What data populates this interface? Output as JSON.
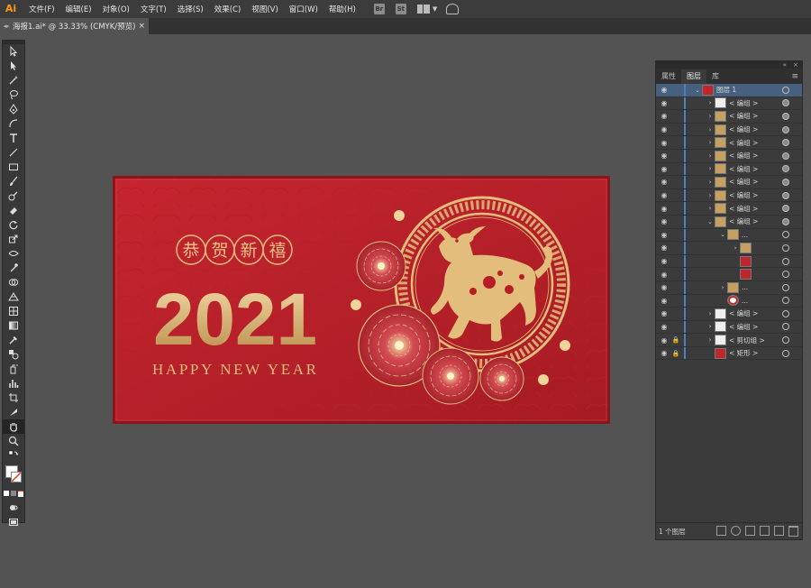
{
  "app": {
    "logo": "Ai"
  },
  "menu": [
    "文件(F)",
    "编辑(E)",
    "对象(O)",
    "文字(T)",
    "选择(S)",
    "效果(C)",
    "视图(V)",
    "窗口(W)",
    "帮助(H)"
  ],
  "toolbar_icons": {
    "bridge": "Br",
    "stock": "St"
  },
  "document_tab": {
    "title": "海报1.ai* @ 33.33% (CMYK/预览)",
    "close": "×"
  },
  "artwork": {
    "chars": [
      "恭",
      "贺",
      "新",
      "禧"
    ],
    "year": "2021",
    "greeting": "HAPPY NEW YEAR",
    "colors": {
      "background": "#b81d26",
      "gold": "#e2bd7c",
      "dark_gold": "#a97a3c",
      "flower": "#c32f3a"
    }
  },
  "layers_panel": {
    "tabs": [
      "属性",
      "图层",
      "库"
    ],
    "menu_icon": "≡",
    "collapse": "«",
    "close": "×",
    "rows": [
      {
        "name": "图层 1",
        "depth": 0,
        "arrow": "open",
        "thumb": "red",
        "selected": true,
        "target": "ring"
      },
      {
        "name": "< 编组 >",
        "depth": 1,
        "arrow": "closed",
        "thumb": "white",
        "target": "filled"
      },
      {
        "name": "< 编组 >",
        "depth": 1,
        "arrow": "closed",
        "thumb": "gold",
        "target": "filled"
      },
      {
        "name": "< 编组 >",
        "depth": 1,
        "arrow": "closed",
        "thumb": "gold",
        "target": "filled"
      },
      {
        "name": "< 编组 >",
        "depth": 1,
        "arrow": "closed",
        "thumb": "gold",
        "target": "filled"
      },
      {
        "name": "< 编组 >",
        "depth": 1,
        "arrow": "closed",
        "thumb": "gold",
        "target": "filled"
      },
      {
        "name": "< 编组 >",
        "depth": 1,
        "arrow": "closed",
        "thumb": "gold",
        "target": "filled"
      },
      {
        "name": "< 编组 >",
        "depth": 1,
        "arrow": "closed",
        "thumb": "gold",
        "target": "filled"
      },
      {
        "name": "< 编组 >",
        "depth": 1,
        "arrow": "closed",
        "thumb": "gold",
        "target": "filled"
      },
      {
        "name": "< 编组 >",
        "depth": 1,
        "arrow": "closed",
        "thumb": "gold",
        "target": "filled"
      },
      {
        "name": "< 编组 >",
        "depth": 1,
        "arrow": "open",
        "thumb": "gold",
        "target": "filled"
      },
      {
        "name": "...",
        "depth": 2,
        "arrow": "open",
        "thumb": "gold",
        "target": "ring"
      },
      {
        "name": "",
        "depth": 3,
        "arrow": "closed",
        "thumb": "gold",
        "target": "ring"
      },
      {
        "name": "",
        "depth": 3,
        "arrow": "none",
        "thumb": "red",
        "target": "ring"
      },
      {
        "name": "",
        "depth": 3,
        "arrow": "none",
        "thumb": "red",
        "target": "ring"
      },
      {
        "name": "...",
        "depth": 2,
        "arrow": "closed",
        "thumb": "gold",
        "target": "ring"
      },
      {
        "name": "...",
        "depth": 2,
        "arrow": "none",
        "thumb": "ring",
        "target": "ring"
      },
      {
        "name": "< 编组 >",
        "depth": 1,
        "arrow": "closed",
        "thumb": "white",
        "target": "ring"
      },
      {
        "name": "< 编组 >",
        "depth": 1,
        "arrow": "closed",
        "thumb": "white",
        "target": "ring"
      },
      {
        "name": "< 剪切组 >",
        "depth": 1,
        "arrow": "closed",
        "thumb": "white",
        "target": "ring",
        "locked": true
      },
      {
        "name": "< 矩形 >",
        "depth": 1,
        "arrow": "none",
        "thumb": "red",
        "target": "ring",
        "locked": true
      }
    ],
    "footer": {
      "count": "1 个图层"
    }
  }
}
